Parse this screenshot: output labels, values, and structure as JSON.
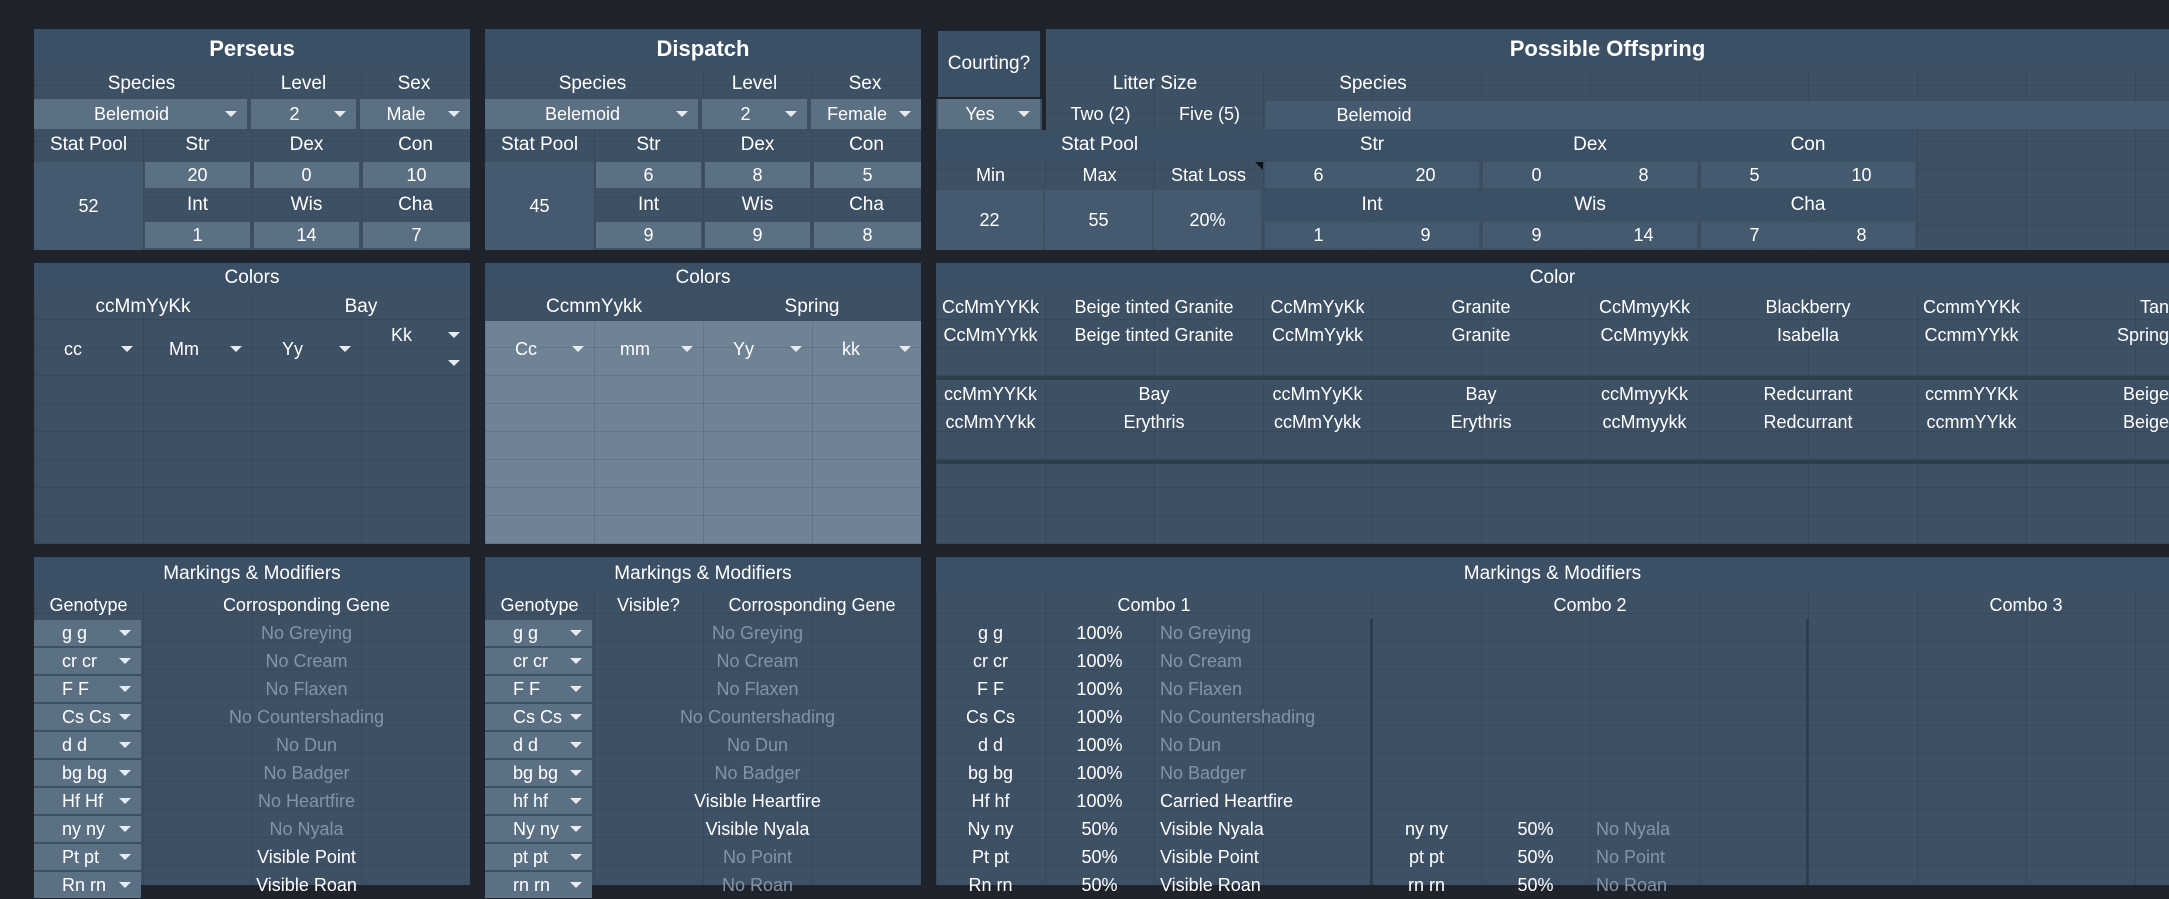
{
  "parent1": {
    "name": "Perseus",
    "headers": {
      "species": "Species",
      "level": "Level",
      "sex": "Sex"
    },
    "species": "Belemoid",
    "level": "2",
    "sex": "Male",
    "stat_pool_label": "Stat Pool",
    "stat_pool": "52",
    "stats": [
      {
        "label": "Str",
        "value": "20"
      },
      {
        "label": "Dex",
        "value": "0"
      },
      {
        "label": "Con",
        "value": "10"
      },
      {
        "label": "Int",
        "value": "1"
      },
      {
        "label": "Wis",
        "value": "14"
      },
      {
        "label": "Cha",
        "value": "7"
      }
    ],
    "colors_title": "Colors",
    "genotype": "ccMmYyKk",
    "color_name": "Bay",
    "genes": [
      "cc",
      "Mm",
      "Yy",
      "Kk"
    ],
    "markings_title": "Markings & Modifiers",
    "col_genotype": "Genotype",
    "col_gene": "Corrosponding Gene",
    "markings": [
      {
        "g": "g g",
        "d": "No Greying",
        "v": false
      },
      {
        "g": "cr cr",
        "d": "No Cream",
        "v": false
      },
      {
        "g": "F F",
        "d": "No Flaxen",
        "v": false
      },
      {
        "g": "Cs Cs",
        "d": "No Countershading",
        "v": false
      },
      {
        "g": "d d",
        "d": "No Dun",
        "v": false
      },
      {
        "g": "bg bg",
        "d": "No Badger",
        "v": false
      },
      {
        "g": "Hf Hf",
        "d": "No Heartfire",
        "v": false
      },
      {
        "g": "ny ny",
        "d": "No Nyala",
        "v": false
      },
      {
        "g": "Pt pt",
        "d": "Visible Point",
        "v": true
      },
      {
        "g": "Rn rn",
        "d": "Visible Roan",
        "v": true
      }
    ]
  },
  "parent2": {
    "name": "Dispatch",
    "headers": {
      "species": "Species",
      "level": "Level",
      "sex": "Sex"
    },
    "species": "Belemoid",
    "level": "2",
    "sex": "Female",
    "stat_pool_label": "Stat Pool",
    "stat_pool": "45",
    "stats": [
      {
        "label": "Str",
        "value": "6"
      },
      {
        "label": "Dex",
        "value": "8"
      },
      {
        "label": "Con",
        "value": "5"
      },
      {
        "label": "Int",
        "value": "9"
      },
      {
        "label": "Wis",
        "value": "9"
      },
      {
        "label": "Cha",
        "value": "8"
      }
    ],
    "colors_title": "Colors",
    "genotype": "CcmmYykk",
    "color_name": "Spring",
    "genes": [
      "Cc",
      "mm",
      "Yy",
      "kk"
    ],
    "markings_title": "Markings & Modifiers",
    "col_genotype": "Genotype",
    "col_visible": "Visible?",
    "col_gene": "Corrosponding Gene",
    "markings": [
      {
        "g": "g g",
        "d": "No Greying",
        "v": false
      },
      {
        "g": "cr cr",
        "d": "No Cream",
        "v": false
      },
      {
        "g": "F F",
        "d": "No Flaxen",
        "v": false
      },
      {
        "g": "Cs Cs",
        "d": "No Countershading",
        "v": false
      },
      {
        "g": "d d",
        "d": "No Dun",
        "v": false
      },
      {
        "g": "bg bg",
        "d": "No Badger",
        "v": false
      },
      {
        "g": "hf hf",
        "d": "Visible Heartfire",
        "v": true
      },
      {
        "g": "Ny ny",
        "d": "Visible Nyala",
        "v": true
      },
      {
        "g": "pt pt",
        "d": "No Point",
        "v": false
      },
      {
        "g": "rn rn",
        "d": "No Roan",
        "v": false
      }
    ]
  },
  "courting": {
    "label": "Courting?",
    "value": "Yes"
  },
  "offspring": {
    "title": "Possible Offspring",
    "litter_label": "Litter Size",
    "litter_min": "Two (2)",
    "litter_max": "Five (5)",
    "species_label": "Species",
    "species": "Belemoid",
    "stat_pool_label": "Stat Pool",
    "min_label": "Min",
    "max_label": "Max",
    "loss_label": "Stat Loss",
    "min": "22",
    "max": "55",
    "loss": "20%",
    "stats": [
      {
        "label": "Str",
        "min": "6",
        "max": "20"
      },
      {
        "label": "Dex",
        "min": "0",
        "max": "8"
      },
      {
        "label": "Con",
        "min": "5",
        "max": "10"
      },
      {
        "label": "Int",
        "min": "1",
        "max": "9"
      },
      {
        "label": "Wis",
        "min": "9",
        "max": "14"
      },
      {
        "label": "Cha",
        "min": "7",
        "max": "8"
      }
    ],
    "color_title": "Color",
    "color_rows": [
      [
        "CcMmYYKk",
        "Beige tinted Granite",
        "CcMmYyKk",
        "Granite",
        "CcMmyyKk",
        "Blackberry",
        "CcmmYYKk",
        "Tan"
      ],
      [
        "CcMmYYkk",
        "Beige tinted Granite",
        "CcMmYykk",
        "Granite",
        "CcMmyykk",
        "Isabella",
        "CcmmYYkk",
        "Spring"
      ],
      [
        "ccMmYYKk",
        "Bay",
        "ccMmYyKk",
        "Bay",
        "ccMmyyKk",
        "Redcurrant",
        "ccmmYYKk",
        "Beige"
      ],
      [
        "ccMmYYkk",
        "Erythris",
        "ccMmYykk",
        "Erythris",
        "ccMmyykk",
        "Redcurrant",
        "ccmmYYkk",
        "Beige"
      ]
    ],
    "markings_title": "Markings & Modifiers",
    "combo1": "Combo 1",
    "combo2": "Combo 2",
    "combo3": "Combo 3",
    "combo1_rows": [
      {
        "g": "g g",
        "p": "100%",
        "d": "No Greying",
        "v": false
      },
      {
        "g": "cr cr",
        "p": "100%",
        "d": "No Cream",
        "v": false
      },
      {
        "g": "F F",
        "p": "100%",
        "d": "No Flaxen",
        "v": false
      },
      {
        "g": "Cs Cs",
        "p": "100%",
        "d": "No Countershading",
        "v": false
      },
      {
        "g": "d d",
        "p": "100%",
        "d": "No Dun",
        "v": false
      },
      {
        "g": "bg bg",
        "p": "100%",
        "d": "No Badger",
        "v": false
      },
      {
        "g": "Hf hf",
        "p": "100%",
        "d": "Carried Heartfire",
        "v": true
      },
      {
        "g": "Ny ny",
        "p": "50%",
        "d": "Visible Nyala",
        "v": true
      },
      {
        "g": "Pt pt",
        "p": "50%",
        "d": "Visible Point",
        "v": true
      },
      {
        "g": "Rn rn",
        "p": "50%",
        "d": "Visible Roan",
        "v": true
      }
    ],
    "combo2_rows": [
      {
        "g": "ny ny",
        "p": "50%",
        "d": "No Nyala",
        "v": false
      },
      {
        "g": "pt pt",
        "p": "50%",
        "d": "No Point",
        "v": false
      },
      {
        "g": "rn rn",
        "p": "50%",
        "d": "No Roan",
        "v": false
      }
    ]
  },
  "colors": {
    "bg": "#1f232b",
    "panel": "#3e5164",
    "input": "#5c7083",
    "dim_text": "#8594a5"
  }
}
